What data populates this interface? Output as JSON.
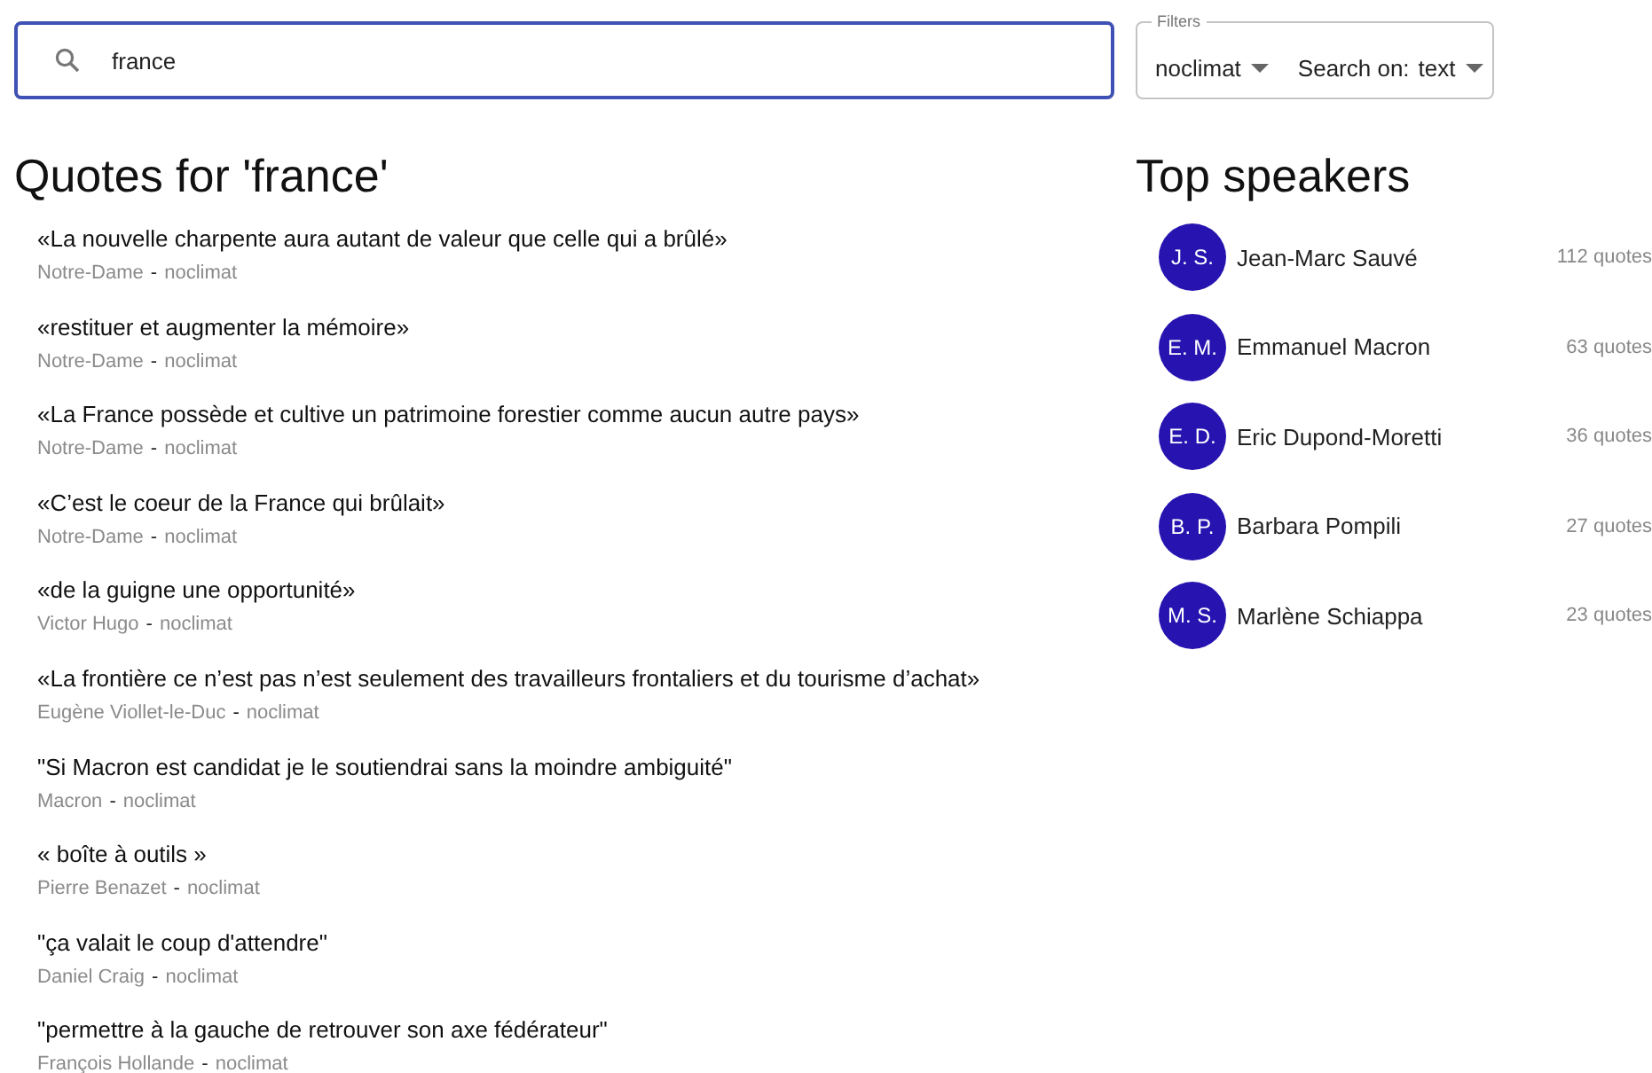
{
  "search": {
    "value": "france",
    "focused": true
  },
  "filters": {
    "legend": "Filters",
    "source": {
      "value": "noclimat"
    },
    "search_on": {
      "label": "Search on:",
      "value": "text"
    }
  },
  "quotes_title": "Quotes for 'france'",
  "quotes": [
    {
      "text": "«La nouvelle charpente aura autant de valeur que celle qui a brûlé»",
      "source": "Notre-Dame",
      "separator": "-",
      "tag": "noclimat"
    },
    {
      "text": "«restituer et augmenter la mémoire»",
      "source": "Notre-Dame",
      "separator": "-",
      "tag": "noclimat"
    },
    {
      "text": "«La France possède et cultive un patrimoine forestier comme aucun autre pays»",
      "source": "Notre-Dame",
      "separator": "-",
      "tag": "noclimat"
    },
    {
      "text": "«C’est le coeur de la France qui brûlait»",
      "source": "Notre-Dame",
      "separator": "-",
      "tag": "noclimat"
    },
    {
      "text": "«de la guigne une opportunité»",
      "source": "Victor Hugo",
      "separator": "-",
      "tag": "noclimat"
    },
    {
      "text": "«La frontière ce n’est pas n’est seulement des travailleurs frontaliers et du tourisme d’achat»",
      "source": "Eugène Viollet-le-Duc",
      "separator": "-",
      "tag": "noclimat"
    },
    {
      "text": "\"Si Macron est candidat je le soutiendrai sans la moindre ambiguité\"",
      "source": "Macron",
      "separator": "-",
      "tag": "noclimat"
    },
    {
      "text": "« boîte à outils »",
      "source": "Pierre Benazet",
      "separator": "-",
      "tag": "noclimat"
    },
    {
      "text": "\"ça valait le coup d'attendre\"",
      "source": "Daniel Craig",
      "separator": "-",
      "tag": "noclimat"
    },
    {
      "text": "\"permettre à la gauche de retrouver son axe fédérateur\"",
      "source": "François Hollande",
      "separator": "-",
      "tag": "noclimat"
    }
  ],
  "speakers_title": "Top speakers",
  "speakers": [
    {
      "initials": "J. S.",
      "name": "Jean-Marc Sauvé",
      "count": "112 quotes"
    },
    {
      "initials": "E. M.",
      "name": "Emmanuel Macron",
      "count": "63 quotes"
    },
    {
      "initials": "E. D.",
      "name": "Eric Dupond-Moretti",
      "count": "36 quotes"
    },
    {
      "initials": "B. P.",
      "name": "Barbara Pompili",
      "count": "27 quotes"
    },
    {
      "initials": "M. S.",
      "name": "Marlène Schiappa",
      "count": "23 quotes"
    }
  ]
}
